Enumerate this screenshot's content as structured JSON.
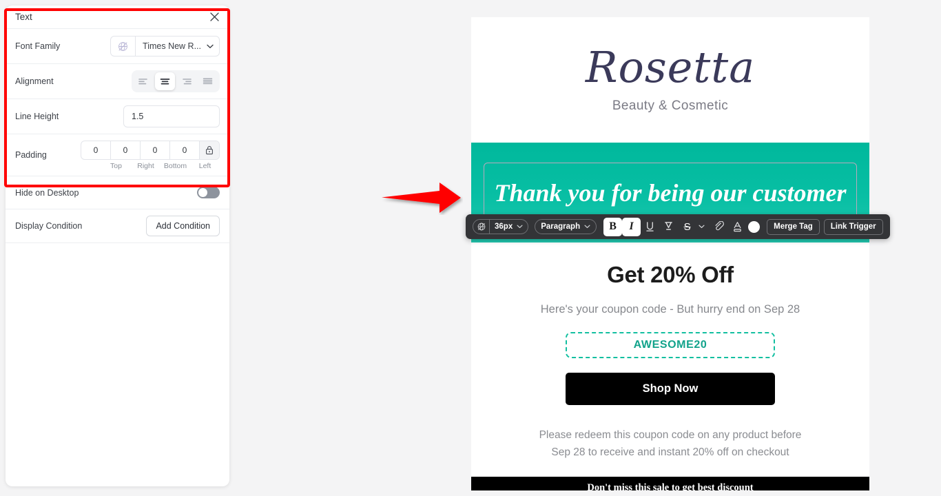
{
  "panel": {
    "title": "Text",
    "close_icon": "close-icon",
    "rows": {
      "font_family": {
        "label": "Font Family",
        "globe_icon": "globe-slash-icon",
        "value": "Times New R...",
        "chevron_icon": "chevron-down-icon"
      },
      "alignment": {
        "label": "Alignment",
        "options": [
          {
            "name": "align-left",
            "selected": false
          },
          {
            "name": "align-center",
            "selected": true
          },
          {
            "name": "align-right",
            "selected": false
          },
          {
            "name": "align-justify",
            "selected": false
          }
        ]
      },
      "line_height": {
        "label": "Line Height",
        "value": "1.5",
        "placeholder": "1.5"
      },
      "padding": {
        "label": "Padding",
        "values": [
          "0",
          "0",
          "0",
          "0"
        ],
        "sides": [
          "Top",
          "Right",
          "Bottom",
          "Left"
        ],
        "lock_icon": "lock-icon"
      },
      "hide_on_desktop": {
        "label": "Hide on Desktop",
        "state": "off"
      },
      "display_condition": {
        "label": "Display Condition",
        "button_label": "Add Condition"
      }
    }
  },
  "annotation": {
    "arrow_color": "#ff0000",
    "highlight_color": "#ff0000"
  },
  "toolbar": {
    "font_size": {
      "globe_icon": "globe-slash-icon",
      "value": "36px",
      "chevron_icon": "chevron-down-icon"
    },
    "block_type": {
      "value": "Paragraph",
      "chevron_icon": "chevron-down-icon"
    },
    "bold": {
      "label": "B",
      "active": false
    },
    "italic": {
      "label": "I",
      "active": true
    },
    "underline": {
      "label": "U",
      "active": false
    },
    "highlight_icon": "highlighter-icon",
    "strikethrough": {
      "label": "S",
      "active": false
    },
    "strikethrough_chevron": "chevron-down-icon",
    "link_icon": "link-icon",
    "text_color_icon": "text-color-icon",
    "color_swatch": "#ffffff",
    "merge_tag_label": "Merge Tag",
    "link_trigger_label": "Link Trigger"
  },
  "email": {
    "logo": {
      "name": "Rosetta",
      "tagline": "Beauty & Cosmetic"
    },
    "banner": {
      "text": "Thank you for being our customer",
      "bg_color": "#0ebfa2",
      "text_color": "#ffffff"
    },
    "headline": "Get 20% Off",
    "subline": "Here's your coupon code - But hurry end on Sep 28",
    "coupon_code": "AWESOME20",
    "coupon_color": "#12a38b",
    "cta_label": "Shop Now",
    "fineprint_line1": "Please redeem this coupon code on any product before",
    "fineprint_line2": "Sep 28 to receive and instant 20% off on checkout",
    "footer_text": "Don't miss this sale to get best discount"
  }
}
